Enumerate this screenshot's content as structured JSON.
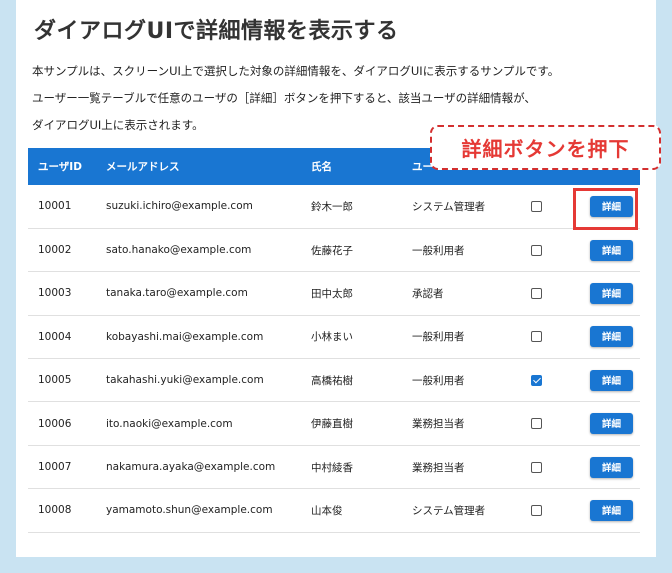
{
  "page": {
    "title": "ダイアログUIで詳細情報を表示する",
    "description": [
      "本サンプルは、スクリーンUI上で選択した対象の詳細情報を、ダイアログUIに表示するサンプルです。",
      "ユーザー一覧テーブルで任意のユーザの［詳細］ボタンを押下すると、該当ユーザの詳細情報が、",
      "ダイアログUI上に表示されます。"
    ]
  },
  "table": {
    "headers": [
      "ユーザID",
      "メールアドレス",
      "氏名",
      "ユー",
      "",
      ""
    ],
    "rows": [
      {
        "id": "10001",
        "email": "suzuki.ichiro@example.com",
        "name": "鈴木一郎",
        "role": "システム管理者",
        "checked": false,
        "action": "詳細"
      },
      {
        "id": "10002",
        "email": "sato.hanako@example.com",
        "name": "佐藤花子",
        "role": "一般利用者",
        "checked": false,
        "action": "詳細"
      },
      {
        "id": "10003",
        "email": "tanaka.taro@example.com",
        "name": "田中太郎",
        "role": "承認者",
        "checked": false,
        "action": "詳細"
      },
      {
        "id": "10004",
        "email": "kobayashi.mai@example.com",
        "name": "小林まい",
        "role": "一般利用者",
        "checked": false,
        "action": "詳細"
      },
      {
        "id": "10005",
        "email": "takahashi.yuki@example.com",
        "name": "高橋祐樹",
        "role": "一般利用者",
        "checked": true,
        "action": "詳細"
      },
      {
        "id": "10006",
        "email": "ito.naoki@example.com",
        "name": "伊藤直樹",
        "role": "業務担当者",
        "checked": false,
        "action": "詳細"
      },
      {
        "id": "10007",
        "email": "nakamura.ayaka@example.com",
        "name": "中村綾香",
        "role": "業務担当者",
        "checked": false,
        "action": "詳細"
      },
      {
        "id": "10008",
        "email": "yamamoto.shun@example.com",
        "name": "山本俊",
        "role": "システム管理者",
        "checked": false,
        "action": "詳細"
      }
    ]
  },
  "annotation": {
    "callout_text": "詳細ボタンを押下",
    "color": "#e53935"
  },
  "colors": {
    "primary": "#1976d2",
    "background": "#c9e3f2"
  }
}
